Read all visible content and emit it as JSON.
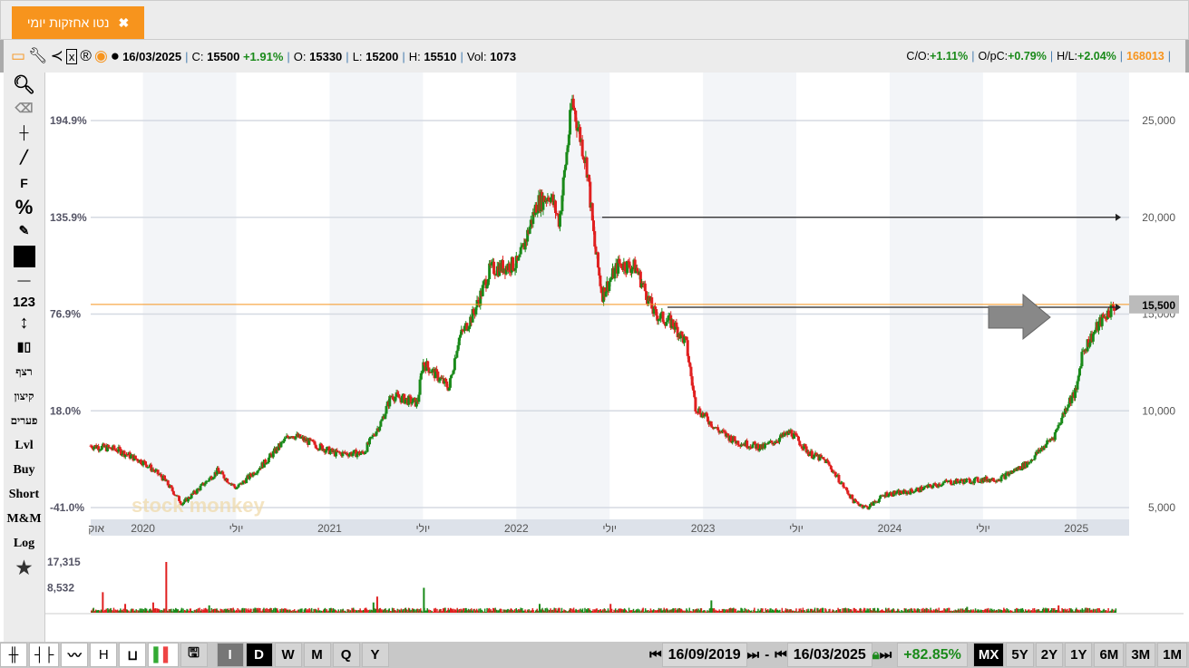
{
  "tab": {
    "title": "נטו אחזקות יומי",
    "close": "✖"
  },
  "info": {
    "date": "16/03/2025",
    "c_label": "C:",
    "close": "15500",
    "change": "+1.91%",
    "o_label": "O:",
    "open": "15330",
    "l_label": "L:",
    "low": "15200",
    "h_label": "H:",
    "high": "15510",
    "vol_label": "Vol:",
    "vol": "1073",
    "co_label": "C/O:",
    "co": "+1.11%",
    "opc_label": "O/pC:",
    "opc": "+0.79%",
    "hl_label": "H/L:",
    "hl": "+2.04%",
    "id": "168013"
  },
  "toolbar_icons": [
    "window-icon",
    "wrench-icon",
    "share-icon",
    "excel-icon",
    "registered-icon",
    "target-icon",
    "comment-icon"
  ],
  "left_tools": {
    "continuous": "רצף",
    "split": "קיצון",
    "gaps": "פערים",
    "lvl": "Lvl",
    "buy": "Buy",
    "short": "Short",
    "mm": "M&M",
    "log": "Log",
    "num": "123",
    "f": "F",
    "pct": "%"
  },
  "bottom": {
    "modes": [
      "I",
      "D",
      "W",
      "M",
      "Q",
      "Y"
    ],
    "active_mode": "D",
    "from": "16/09/2019",
    "dash": "-",
    "to": "16/03/2025",
    "change": "+82.85%",
    "ranges": [
      "MX",
      "5Y",
      "2Y",
      "1Y",
      "6M",
      "3M",
      "1M"
    ],
    "active_range": "MX"
  },
  "colors": {
    "up": "#1a8a1a",
    "down": "#e02020",
    "accent": "#f7941d"
  },
  "chart_data": {
    "type": "candlestick",
    "price_ticks": [
      5000,
      10000,
      15000,
      20000,
      25000
    ],
    "price_tick_labels": [
      "5,000",
      "10,000",
      "15,000",
      "20,000",
      "25,000"
    ],
    "pct_tick_labels": [
      "194.9%",
      "135.9%",
      "76.9%",
      "18.0%",
      "-41.0%"
    ],
    "pct_tick_prices": [
      25000,
      20000,
      15000,
      10000,
      5000
    ],
    "x_labels": [
      {
        "t": 2019.75,
        "label": "אוק"
      },
      {
        "t": 2020.0,
        "label": "2020"
      },
      {
        "t": 2020.5,
        "label": "יולי"
      },
      {
        "t": 2021.0,
        "label": "2021"
      },
      {
        "t": 2021.5,
        "label": "יולי"
      },
      {
        "t": 2022.0,
        "label": "2022"
      },
      {
        "t": 2022.5,
        "label": "יולי"
      },
      {
        "t": 2023.0,
        "label": "2023"
      },
      {
        "t": 2023.5,
        "label": "יולי"
      },
      {
        "t": 2024.0,
        "label": "2024"
      },
      {
        "t": 2024.5,
        "label": "יולי"
      },
      {
        "t": 2025.0,
        "label": "2025"
      }
    ],
    "xlim": [
      2019.72,
      2025.21
    ],
    "ylim": [
      4800,
      27300
    ],
    "price_path": [
      [
        2019.72,
        8200
      ],
      [
        2019.86,
        8000
      ],
      [
        2020.01,
        7300
      ],
      [
        2020.11,
        6500
      ],
      [
        2020.21,
        5200
      ],
      [
        2020.28,
        5800
      ],
      [
        2020.4,
        6900
      ],
      [
        2020.5,
        6000
      ],
      [
        2020.65,
        7300
      ],
      [
        2020.79,
        8800
      ],
      [
        2020.91,
        8300
      ],
      [
        2021.03,
        7800
      ],
      [
        2021.18,
        7800
      ],
      [
        2021.28,
        9500
      ],
      [
        2021.33,
        10800
      ],
      [
        2021.47,
        10400
      ],
      [
        2021.5,
        12500
      ],
      [
        2021.64,
        11200
      ],
      [
        2021.69,
        13700
      ],
      [
        2021.77,
        15000
      ],
      [
        2021.86,
        17300
      ],
      [
        2022.01,
        17600
      ],
      [
        2022.11,
        20700
      ],
      [
        2022.18,
        21200
      ],
      [
        2022.23,
        19800
      ],
      [
        2022.3,
        26000
      ],
      [
        2022.38,
        22500
      ],
      [
        2022.42,
        18500
      ],
      [
        2022.46,
        16000
      ],
      [
        2022.55,
        17600
      ],
      [
        2022.64,
        17400
      ],
      [
        2022.74,
        15000
      ],
      [
        2022.84,
        14500
      ],
      [
        2022.91,
        13500
      ],
      [
        2022.96,
        10200
      ],
      [
        2023.08,
        9000
      ],
      [
        2023.18,
        8400
      ],
      [
        2023.32,
        8100
      ],
      [
        2023.47,
        8900
      ],
      [
        2023.57,
        7800
      ],
      [
        2023.66,
        7400
      ],
      [
        2023.81,
        5300
      ],
      [
        2023.88,
        5000
      ],
      [
        2023.98,
        5700
      ],
      [
        2024.1,
        5800
      ],
      [
        2024.3,
        6300
      ],
      [
        2024.44,
        6400
      ],
      [
        2024.59,
        6500
      ],
      [
        2024.74,
        7300
      ],
      [
        2024.88,
        8700
      ],
      [
        2024.96,
        10500
      ],
      [
        2025.0,
        11000
      ],
      [
        2025.03,
        13000
      ],
      [
        2025.13,
        14600
      ],
      [
        2025.21,
        15500
      ]
    ],
    "volume_ticks": [
      17315,
      8532
    ],
    "volume_tick_labels": [
      "17,315",
      "8,532"
    ],
    "volume_spikes": [
      [
        2019.78,
        7000,
        "down"
      ],
      [
        2019.9,
        3000,
        "down"
      ],
      [
        2020.12,
        17315,
        "down"
      ],
      [
        2020.05,
        3500,
        "down"
      ],
      [
        2020.35,
        2500,
        "green"
      ],
      [
        2021.25,
        5500,
        "down"
      ],
      [
        2021.23,
        3500,
        "green"
      ],
      [
        2021.5,
        8500,
        "green"
      ],
      [
        2022.12,
        3000,
        "green"
      ],
      [
        2023.04,
        4200,
        "green"
      ],
      [
        2022.5,
        3000,
        "down"
      ],
      [
        2024.9,
        2500,
        "down"
      ],
      [
        2024.41,
        2000,
        "green"
      ]
    ],
    "lines": [
      {
        "price": 15500,
        "kind": "horizontal",
        "color": "#f7941d"
      },
      {
        "price": 20000,
        "from": 2022.46,
        "kind": "arrow"
      },
      {
        "price": 15350,
        "from": 2022.81,
        "kind": "arrow"
      }
    ],
    "last_price_label": "15,500",
    "watermark": "stock monkey"
  }
}
